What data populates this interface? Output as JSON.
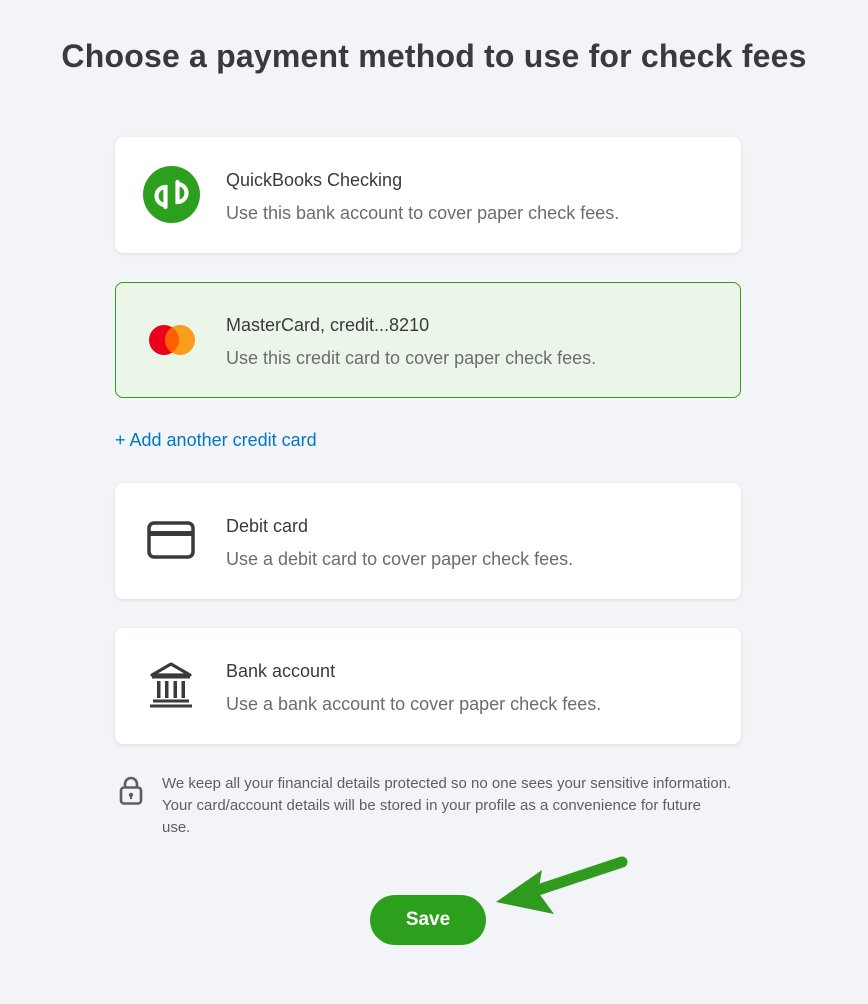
{
  "page": {
    "title": "Choose a payment method to use for check fees"
  },
  "options": [
    {
      "icon": "quickbooks-logo-icon",
      "title": "QuickBooks Checking",
      "description": "Use this bank account to cover paper check fees.",
      "selected": false
    },
    {
      "icon": "mastercard-logo-icon",
      "title": "MasterCard, credit...8210",
      "description": "Use this credit card to cover paper check fees.",
      "selected": true
    },
    {
      "icon": "credit-card-icon",
      "title": "Debit card",
      "description": "Use a debit card to cover paper check fees.",
      "selected": false
    },
    {
      "icon": "bank-icon",
      "title": "Bank account",
      "description": "Use a bank account to cover paper check fees.",
      "selected": false
    }
  ],
  "add_credit_card": {
    "label": "+ Add another credit card"
  },
  "security_note": {
    "icon": "lock-icon",
    "text": "We keep all your financial details protected so no one sees your sensitive information. Your card/account details will be stored in your profile as a convenience for future use."
  },
  "actions": {
    "save_label": "Save"
  },
  "annotation": {
    "icon": "green-arrow-icon"
  },
  "colors": {
    "brand_green": "#2ca01c",
    "selected_background": "#ebf6e9",
    "link_blue": "#0077c5",
    "page_background": "#f3f4f7"
  }
}
